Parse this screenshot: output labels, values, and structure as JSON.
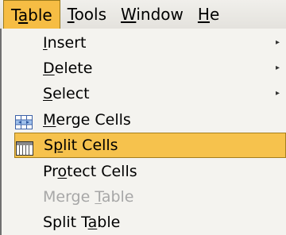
{
  "menubar": {
    "items": [
      {
        "pre": "T",
        "key": "a",
        "post": "ble"
      },
      {
        "pre": "",
        "key": "T",
        "post": "ools"
      },
      {
        "pre": "",
        "key": "W",
        "post": "indow"
      },
      {
        "pre": "",
        "key": "H",
        "post": "e"
      }
    ],
    "active_index": 0
  },
  "table_menu": {
    "items": [
      {
        "pre": "",
        "key": "I",
        "post": "nsert",
        "submenu": true,
        "state": "normal",
        "icon": null
      },
      {
        "pre": "",
        "key": "D",
        "post": "elete",
        "submenu": true,
        "state": "normal",
        "icon": null
      },
      {
        "pre": "",
        "key": "S",
        "post": "elect",
        "submenu": true,
        "state": "normal",
        "icon": null
      },
      {
        "pre": "",
        "key": "M",
        "post": "erge Cells",
        "submenu": false,
        "state": "normal",
        "icon": "merge-cells-icon"
      },
      {
        "pre": "S",
        "key": "p",
        "post": "lit Cells",
        "submenu": false,
        "state": "highlighted",
        "icon": "split-cells-icon"
      },
      {
        "pre": "Pr",
        "key": "o",
        "post": "tect Cells",
        "submenu": false,
        "state": "normal",
        "icon": null
      },
      {
        "pre": "Merge ",
        "key": "T",
        "post": "able",
        "submenu": false,
        "state": "disabled",
        "icon": null
      },
      {
        "pre": "Split T",
        "key": "a",
        "post": "ble",
        "submenu": false,
        "state": "normal",
        "icon": null
      }
    ],
    "submenu_arrow": "▸"
  },
  "colors": {
    "highlight": "#f6c24d",
    "highlight_border": "#a67f1d",
    "menu_bg": "#f4f3ef",
    "disabled_text": "#a7a7a7"
  }
}
